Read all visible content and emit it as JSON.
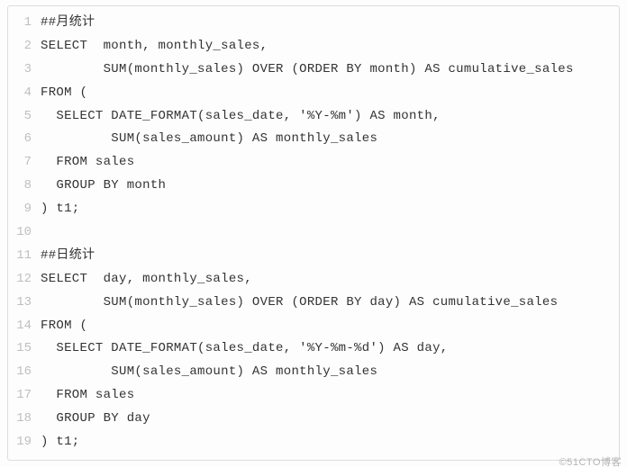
{
  "lines": [
    {
      "num": "1",
      "text": "##月统计"
    },
    {
      "num": "2",
      "text": "SELECT  month, monthly_sales,"
    },
    {
      "num": "3",
      "text": "        SUM(monthly_sales) OVER (ORDER BY month) AS cumulative_sales"
    },
    {
      "num": "4",
      "text": "FROM ("
    },
    {
      "num": "5",
      "text": "  SELECT DATE_FORMAT(sales_date, '%Y-%m') AS month,"
    },
    {
      "num": "6",
      "text": "         SUM(sales_amount) AS monthly_sales"
    },
    {
      "num": "7",
      "text": "  FROM sales"
    },
    {
      "num": "8",
      "text": "  GROUP BY month"
    },
    {
      "num": "9",
      "text": ") t1;"
    },
    {
      "num": "10",
      "text": ""
    },
    {
      "num": "11",
      "text": "##日统计"
    },
    {
      "num": "12",
      "text": "SELECT  day, monthly_sales,"
    },
    {
      "num": "13",
      "text": "        SUM(monthly_sales) OVER (ORDER BY day) AS cumulative_sales"
    },
    {
      "num": "14",
      "text": "FROM ("
    },
    {
      "num": "15",
      "text": "  SELECT DATE_FORMAT(sales_date, '%Y-%m-%d') AS day,"
    },
    {
      "num": "16",
      "text": "         SUM(sales_amount) AS monthly_sales"
    },
    {
      "num": "17",
      "text": "  FROM sales"
    },
    {
      "num": "18",
      "text": "  GROUP BY day"
    },
    {
      "num": "19",
      "text": ") t1;"
    }
  ],
  "watermark": "©51CTO博客"
}
